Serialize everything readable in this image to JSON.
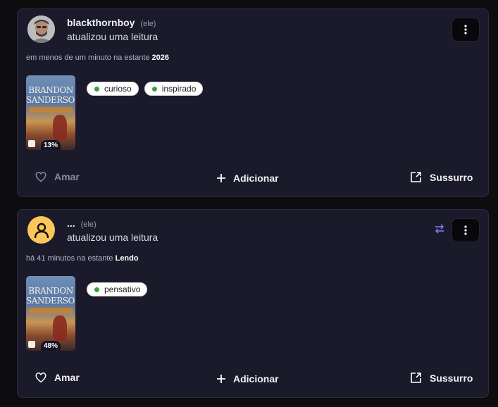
{
  "posts": [
    {
      "username": "blackthornboy",
      "pronoun": "(ele)",
      "action": "atualizou uma leitura",
      "time_prefix": "em menos de um minuto na estante",
      "shelf": "2026",
      "book": {
        "author_line1": "BRANDON",
        "author_line2": "SANDERSON",
        "progress": "13%"
      },
      "moods": [
        "curioso",
        "inspirado"
      ],
      "love_label": "Amar",
      "add_label": "Adicionar",
      "whisper_label": "Sussurro"
    },
    {
      "username": "...",
      "pronoun": "(ele)",
      "action": "atualizou uma leitura",
      "time_prefix": "há 41 minutos na estante",
      "shelf": "Lendo",
      "book": {
        "author_line1": "BRANDON",
        "author_line2": "SANDERSON",
        "progress": "48%"
      },
      "moods": [
        "pensativo"
      ],
      "love_label": "Amar",
      "add_label": "Adicionar",
      "whisper_label": "Sussurro"
    }
  ],
  "colors": {
    "card_bg": "#1b1a2a",
    "accent_swap": "#8b7cf6",
    "mood_dot": "#3aa13a",
    "default_avatar": "#fbc75a"
  }
}
